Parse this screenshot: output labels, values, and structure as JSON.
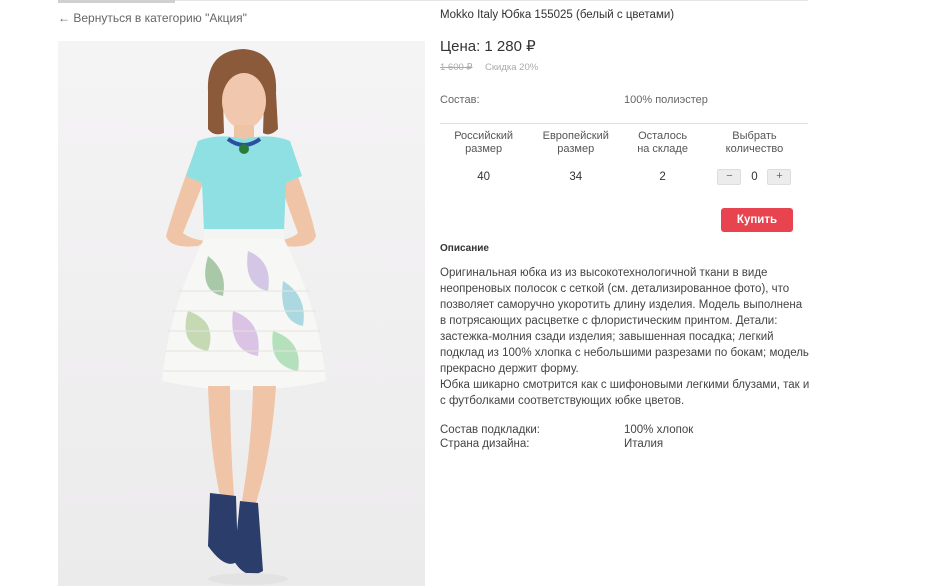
{
  "nav": {
    "back_arrow": "←",
    "back_label": "Вернуться в категорию \"Акция\""
  },
  "product": {
    "title": "Mokko Italy Юбка 155025 (белый с цветами)",
    "price_label": "Цена:",
    "price_value": "1 280",
    "currency": "₽",
    "old_price": "1 600 ₽",
    "discount": "Скидка 20%",
    "composition_label": "Состав:",
    "composition_value": "100% полиэстер"
  },
  "size_table": {
    "headers": [
      [
        "Российский",
        "размер"
      ],
      [
        "Европейский",
        "размер"
      ],
      [
        "Осталось",
        "на складе"
      ],
      [
        "Выбрать",
        "количество"
      ]
    ],
    "row": {
      "ru_size": "40",
      "eu_size": "34",
      "stock": "2",
      "quantity": "0",
      "minus": "−",
      "plus": "+"
    }
  },
  "buy_label": "Купить",
  "description": {
    "title": "Описание",
    "paragraphs": [
      "Оригинальная юбка из из высокотехнологичной ткани в виде неопреновых полосок с сеткой (см. детализированное фото), что позволяет саморучно укоротить длину изделия. Модель выполнена в  потрясающих расцветке с флористическим принтом.  Детали: застежка-молния сзади изделия; завышенная посадка; легкий подклад из 100% хлопка с небольшими разрезами по бокам; модель прекрасно держит форму.",
      "Юбка шикарно смотрится как с шифоновыми легкими блузами, так и с футболками соответствующих юбке цветов."
    ]
  },
  "extra": {
    "lining_label": "Состав подкладки:",
    "lining_value": "100% хлопок",
    "country_label": "Страна дизайна:",
    "country_value": "Италия"
  },
  "colors": {
    "buy_button": "#e8444f",
    "photo_background": "#f3f2f3",
    "top_color": "#8fe0e3",
    "skirt_base": "#f7f7f5"
  },
  "icons": {
    "back": "arrow-left-icon"
  }
}
